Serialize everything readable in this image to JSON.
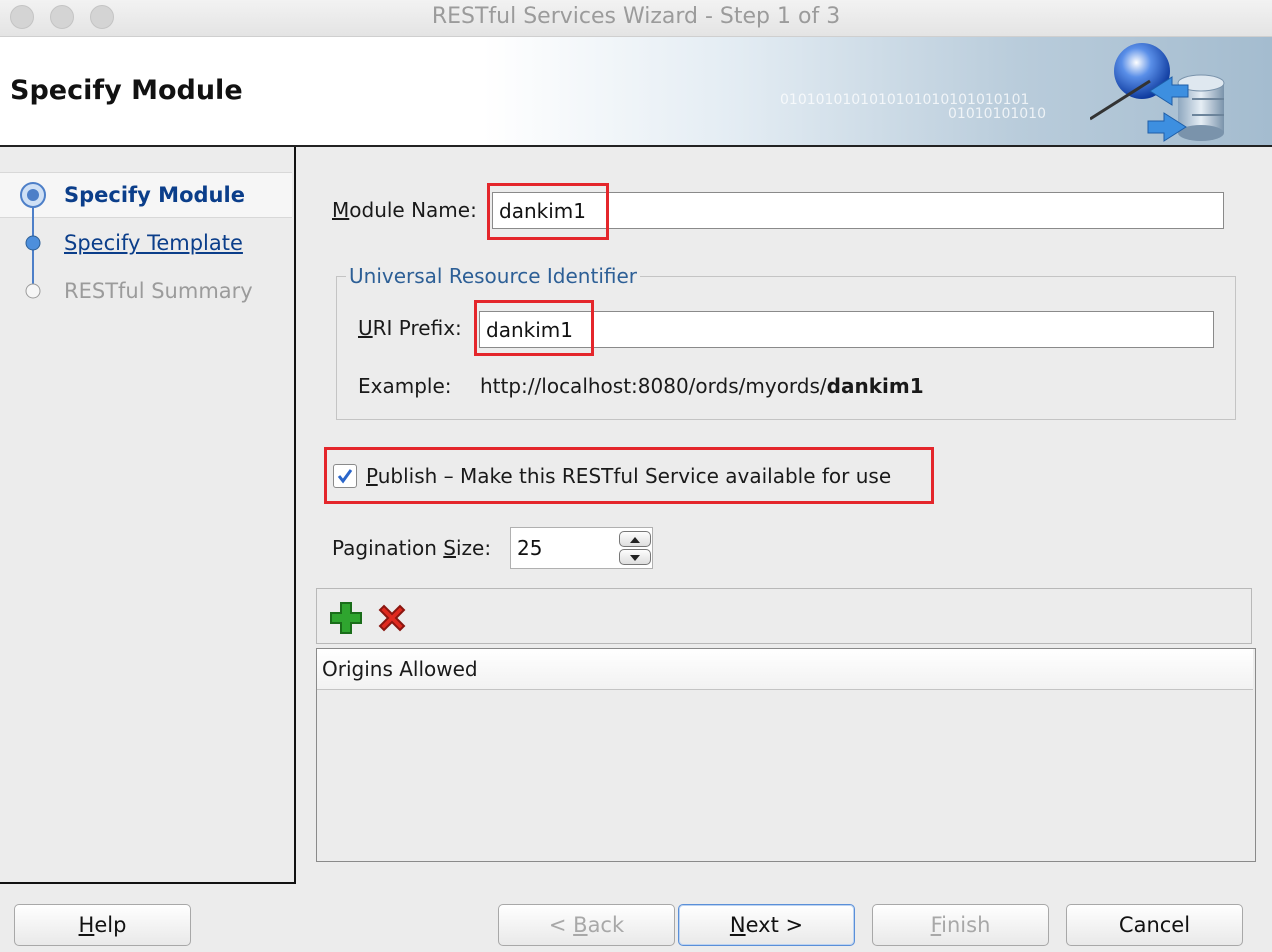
{
  "window": {
    "title": "RESTful Services Wizard - Step 1 of 3"
  },
  "header": {
    "title": "Specify Module",
    "binary_line1": "0101010101010101010101010101",
    "binary_line2": "01010101010"
  },
  "steps": [
    {
      "label": "Specify Module",
      "state": "current"
    },
    {
      "label": "Specify Template",
      "state": "link"
    },
    {
      "label": "RESTful Summary",
      "state": "disabled"
    }
  ],
  "form": {
    "module_name": {
      "label_mnemonic": "M",
      "label_rest": "odule Name:",
      "value": "dankim1"
    },
    "uri_group": {
      "legend": "Universal Resource Identifier"
    },
    "uri_prefix": {
      "label_mnemonic": "U",
      "label_rest": "RI Prefix:",
      "value": "dankim1"
    },
    "example": {
      "label": "Example:",
      "url_base": "http://localhost:8080/ords/myords/",
      "url_module": "dankim1"
    },
    "publish": {
      "checked": true,
      "label_mnemonic": "P",
      "label_rest": "ublish – Make this RESTful Service available for use"
    },
    "pagination": {
      "label_pre": "Pagination ",
      "label_mnemonic": "S",
      "label_post": "ize:",
      "value": "25"
    }
  },
  "origins_table": {
    "column_header": "Origins Allowed",
    "rows": []
  },
  "buttons": {
    "help": {
      "mnemonic": "H",
      "rest": "elp"
    },
    "back": {
      "pre": "< ",
      "mnemonic": "B",
      "rest": "ack"
    },
    "next": {
      "mnemonic": "N",
      "rest": "ext >"
    },
    "finish": {
      "mnemonic": "F",
      "rest": "inish"
    },
    "cancel": {
      "label": "Cancel"
    }
  },
  "colors": {
    "highlight_box": "#e4262b",
    "nav_link": "#0b3e8a",
    "legend": "#2d5f96",
    "add_icon": "#2fa52f",
    "delete_icon": "#e02a1f"
  }
}
